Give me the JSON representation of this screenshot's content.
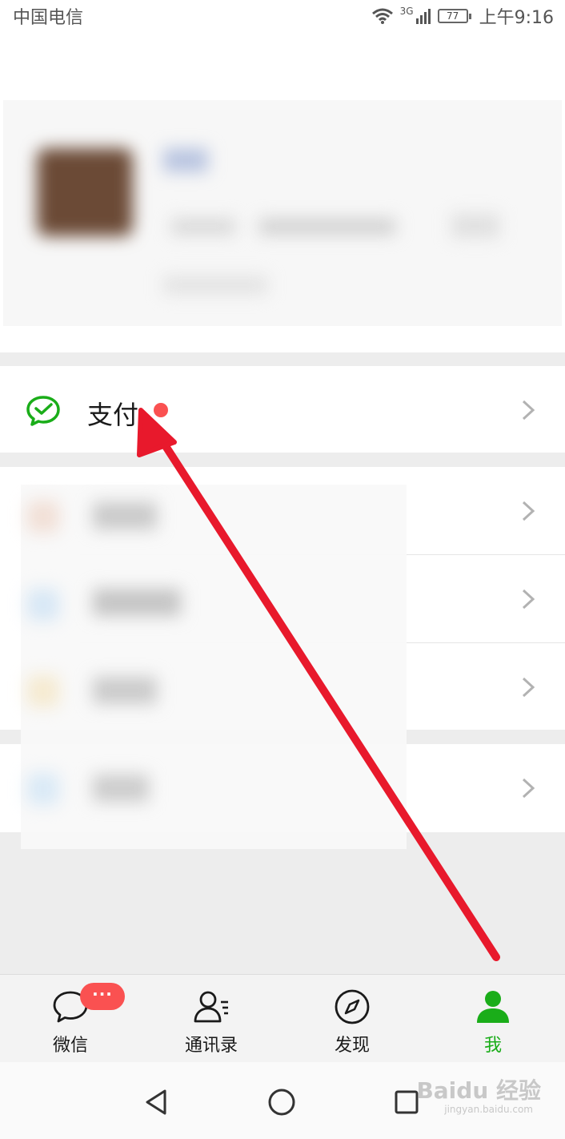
{
  "status_bar": {
    "carrier": "中国电信",
    "network": "3G",
    "battery": "77",
    "time": "上午9:16"
  },
  "menu": {
    "pay_label": "支付"
  },
  "tab_bar": {
    "items": [
      {
        "label": "微信",
        "icon": "chat-bubble-icon"
      },
      {
        "label": "通讯录",
        "icon": "contacts-icon"
      },
      {
        "label": "发现",
        "icon": "compass-icon"
      },
      {
        "label": "我",
        "icon": "person-icon"
      }
    ],
    "active_index": 3,
    "chats_badge": "···"
  },
  "watermark": {
    "text": "Baidu 经验",
    "sub": "jingyan.baidu.com"
  },
  "colors": {
    "accent_green": "#1aad19",
    "badge_red": "#fa5151",
    "arrow_red": "#e8192c",
    "background": "#ededed"
  }
}
